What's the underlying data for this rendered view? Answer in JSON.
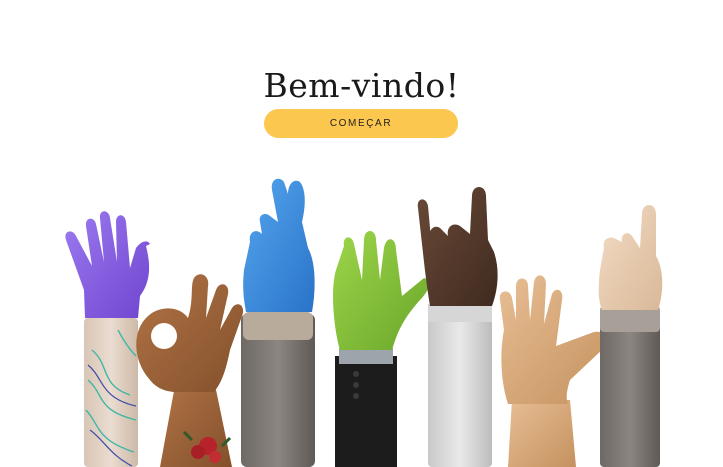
{
  "welcome": {
    "title": "Bem-vindo!",
    "start_label": "COMEÇAR"
  },
  "illustration": {
    "subject": "raised-hands-illustration",
    "colors": {
      "button": "#fbc74e",
      "purple_glove": "#8b62e6",
      "blue_glove": "#3f8ee0",
      "green_glove": "#86c43a"
    }
  }
}
